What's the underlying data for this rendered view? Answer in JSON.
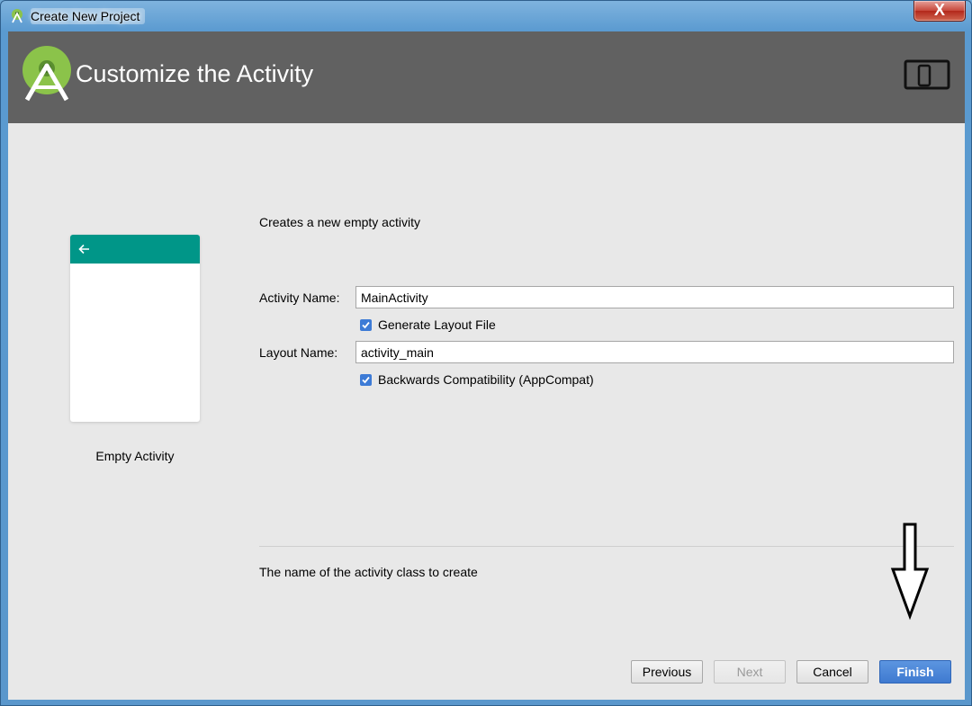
{
  "window": {
    "title": "Create New Project",
    "close_label": "X"
  },
  "header": {
    "title": "Customize the Activity",
    "logo_icon": "android-studio-logo-icon",
    "device_icon": "tablet-phone-icon"
  },
  "preview": {
    "caption": "Empty Activity",
    "bar_color": "#009688"
  },
  "form": {
    "description": "Creates a new empty activity",
    "activity_name_label": "Activity Name:",
    "activity_name_value": "MainActivity",
    "generate_layout_label": "Generate Layout File",
    "generate_layout_checked": true,
    "layout_name_label": "Layout Name:",
    "layout_name_value": "activity_main",
    "backwards_compat_label": "Backwards Compatibility (AppCompat)",
    "backwards_compat_checked": true
  },
  "hint": "The name of the activity class to create",
  "buttons": {
    "previous": "Previous",
    "next": "Next",
    "cancel": "Cancel",
    "finish": "Finish"
  },
  "colors": {
    "header_bg": "#616161",
    "accent": "#3d7bd6",
    "client_bg": "#e8e8e8"
  }
}
